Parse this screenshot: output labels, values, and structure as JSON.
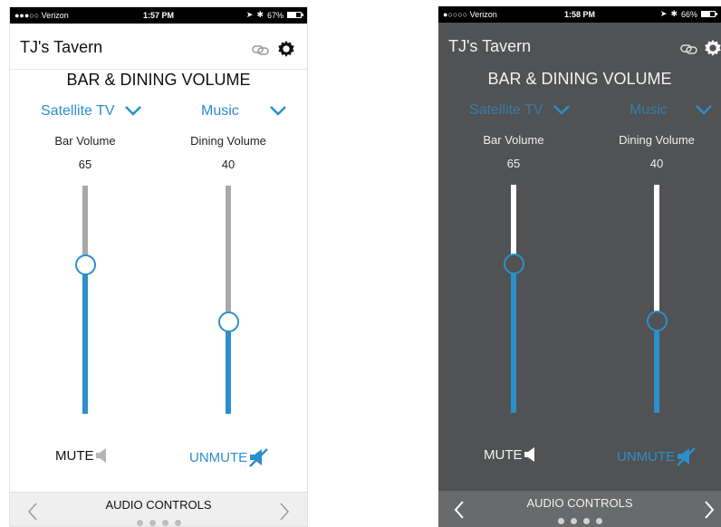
{
  "screens": [
    {
      "status": {
        "carrier": "●●●○○ Verizon",
        "time": "1:57 PM",
        "battery": "67%",
        "battery_level": 0.67
      },
      "app_title": "TJ's Tavern",
      "section_title": "BAR & DINING VOLUME",
      "sources": {
        "left": "Satellite TV",
        "right": "Music"
      },
      "bar": {
        "label": "Bar Volume",
        "value": "65",
        "level": 0.65
      },
      "dining": {
        "label": "Dining Volume",
        "value": "40",
        "level": 0.4
      },
      "mute_label": "MUTE",
      "unmute_label": "UNMUTE",
      "footer_title": "AUDIO CONTROLS",
      "pages": {
        "count": 4,
        "active": 0
      }
    },
    {
      "status": {
        "carrier": "●○○○○ Verizon",
        "time": "1:58 PM",
        "battery": "66%",
        "battery_level": 0.66
      },
      "app_title": "TJ's Tavern",
      "section_title": "BAR & DINING VOLUME",
      "sources": {
        "left": "Satellite TV",
        "right": "Music"
      },
      "bar": {
        "label": "Bar Volume",
        "value": "65",
        "level": 0.65
      },
      "dining": {
        "label": "Dining Volume",
        "value": "40",
        "level": 0.4
      },
      "mute_label": "MUTE",
      "unmute_label": "UNMUTE",
      "footer_title": "AUDIO CONTROLS",
      "pages": {
        "count": 4,
        "active": 0
      }
    }
  ],
  "colors": {
    "accent": "#2b8fcb",
    "light_bg": "#ffffff",
    "dark_bg": "#505253",
    "light_track": "#a9a9ab",
    "dark_track": "#ffffff"
  },
  "icons": {
    "link": "link-icon",
    "settings": "gear-icon",
    "dropdown": "chevron-down-icon",
    "speaker": "speaker-icon",
    "speaker_muted": "speaker-muted-icon",
    "prev": "chevron-left-icon",
    "next": "chevron-right-icon"
  }
}
